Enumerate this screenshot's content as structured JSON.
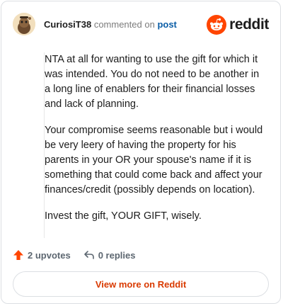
{
  "header": {
    "username": "CuriosiT38",
    "commented_text": "commented on",
    "post_link": "post",
    "brand_name": "reddit",
    "avatar_icon": "snoo-avatar-icon",
    "brand_icon": "reddit-logo-icon"
  },
  "comment": {
    "paragraphs": [
      "NTA at all for wanting to use the gift for which it was intended. You do not need to be another in a long line of enablers for their financial losses and lack of planning.",
      "Your compromise seems reasonable but i would be very leery of having the property for his parents in your OR your spouse's name if it is something that could come back and affect your finances/credit (possibly depends on location).",
      "Invest the gift, YOUR GIFT, wisely."
    ]
  },
  "actions": {
    "upvotes": "2 upvotes",
    "replies": "0 replies",
    "upvote_icon": "upvote-arrow-icon",
    "reply_icon": "reply-arrow-icon"
  },
  "footer": {
    "view_more": "View more on Reddit"
  },
  "colors": {
    "accent": "#d93a00",
    "reddit_orange": "#ff4500",
    "link": "#0a5da6",
    "text": "#1c1c1c",
    "muted": "#7c7c7c",
    "border": "#dcdfe3"
  }
}
